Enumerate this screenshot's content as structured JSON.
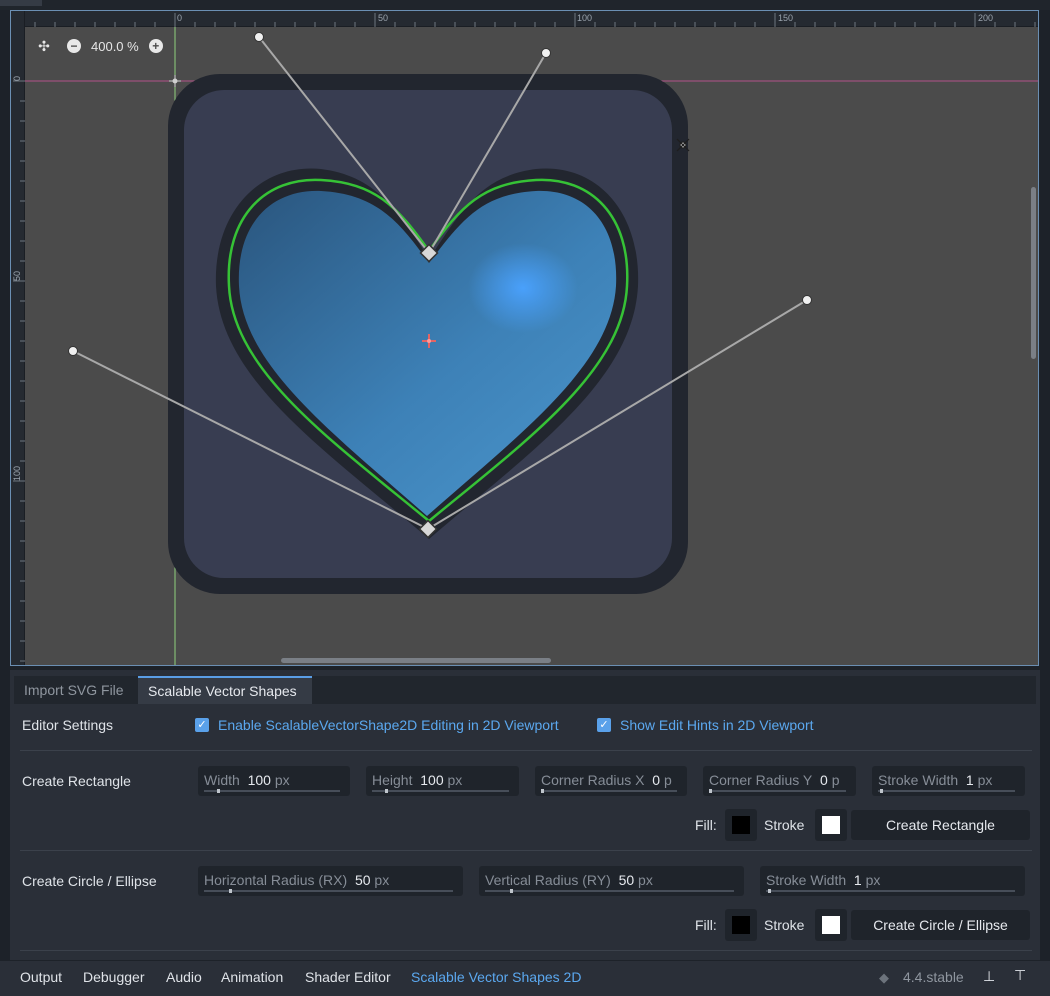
{
  "viewport": {
    "zoom_level": "400.0 %",
    "ruler_top_labels": [
      "0",
      "50",
      "100",
      "150",
      "200"
    ],
    "ruler_left_labels": [
      "0",
      "50",
      "100"
    ],
    "colors": {
      "background": "#4b4b4b",
      "rounded_rect_fill": "#383d50",
      "rounded_rect_stroke": "#23262f",
      "heart_gradient_start": "#2d5f8a",
      "heart_gradient_end": "#4a94cc",
      "heart_outline": "#36c236",
      "guide_horizontal": "#c04080",
      "guide_vertical": "#7bd36e"
    }
  },
  "panel": {
    "tabs": [
      {
        "label": "Import SVG File",
        "active": false
      },
      {
        "label": "Scalable Vector Shapes",
        "active": true
      }
    ],
    "editor_settings": {
      "label": "Editor Settings",
      "enable_editing_label": "Enable ScalableVectorShape2D Editing in 2D Viewport",
      "show_hints_label": "Show Edit Hints in 2D Viewport"
    },
    "create_rectangle": {
      "label": "Create Rectangle",
      "width": {
        "label": "Width",
        "value": "100",
        "unit": "px"
      },
      "height": {
        "label": "Height",
        "value": "100",
        "unit": "px"
      },
      "corner_radius_x": {
        "label": "Corner Radius X",
        "value": "0",
        "unit": "p"
      },
      "corner_radius_y": {
        "label": "Corner Radius Y",
        "value": "0",
        "unit": "p"
      },
      "stroke_width": {
        "label": "Stroke Width",
        "value": "1",
        "unit": "px"
      },
      "fill_label": "Fill:",
      "stroke_label": "Stroke",
      "fill_color": "#000000",
      "stroke_color": "#ffffff",
      "button": "Create Rectangle"
    },
    "create_ellipse": {
      "label": "Create Circle / Ellipse",
      "rx": {
        "label": "Horizontal Radius (RX)",
        "value": "50",
        "unit": "px"
      },
      "ry": {
        "label": "Vertical Radius (RY)",
        "value": "50",
        "unit": "px"
      },
      "stroke_width": {
        "label": "Stroke Width",
        "value": "1",
        "unit": "px"
      },
      "fill_label": "Fill:",
      "stroke_label": "Stroke",
      "fill_color": "#000000",
      "stroke_color": "#ffffff",
      "button": "Create Circle / Ellipse"
    }
  },
  "bottom_bar": {
    "tabs": [
      {
        "label": "Output",
        "active": false
      },
      {
        "label": "Debugger",
        "active": false
      },
      {
        "label": "Audio",
        "active": false
      },
      {
        "label": "Animation",
        "active": false
      },
      {
        "label": "Shader Editor",
        "active": false
      },
      {
        "label": "Scalable Vector Shapes 2D",
        "active": true
      }
    ],
    "version": "4.4.stable"
  }
}
